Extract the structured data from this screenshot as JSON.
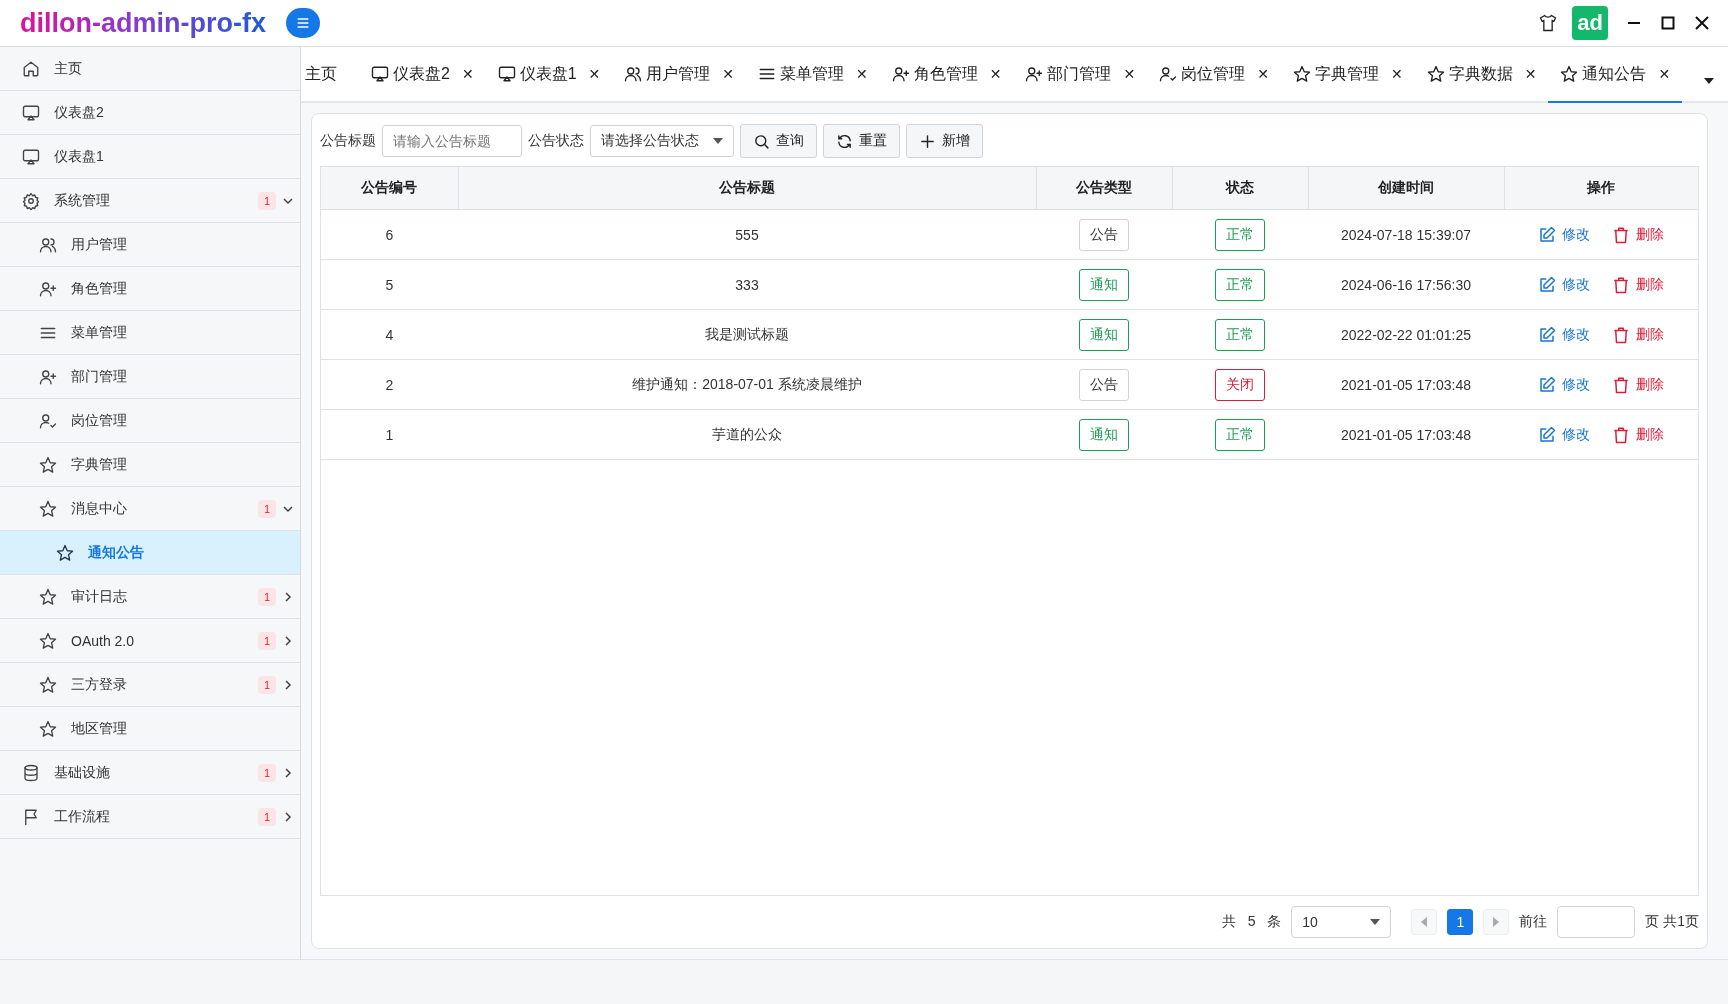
{
  "app_title": "dillon-admin-pro-fx",
  "avatar": "ad",
  "sidebar": [
    {
      "kind": "home",
      "label": "主页",
      "selected": false
    },
    {
      "kind": "monitor",
      "label": "仪表盘2",
      "selected": false
    },
    {
      "kind": "monitor",
      "label": "仪表盘1",
      "selected": false
    },
    {
      "kind": "gear",
      "label": "系统管理",
      "selected": false,
      "badge": "1",
      "expanded": true,
      "children": [
        {
          "kind": "users",
          "label": "用户管理",
          "selected": false
        },
        {
          "kind": "user-plus",
          "label": "角色管理",
          "selected": false
        },
        {
          "kind": "menu",
          "label": "菜单管理",
          "selected": false
        },
        {
          "kind": "user-plus",
          "label": "部门管理",
          "selected": false
        },
        {
          "kind": "user-check",
          "label": "岗位管理",
          "selected": false
        },
        {
          "kind": "star",
          "label": "字典管理",
          "selected": false
        },
        {
          "kind": "star",
          "label": "消息中心",
          "selected": false,
          "badge": "1",
          "expanded": true,
          "children": [
            {
              "kind": "star",
              "label": "通知公告",
              "selected": true
            }
          ]
        },
        {
          "kind": "star",
          "label": "审计日志",
          "selected": false,
          "badge": "1",
          "expanded": false
        },
        {
          "kind": "star",
          "label": "OAuth 2.0",
          "selected": false,
          "badge": "1",
          "expanded": false
        },
        {
          "kind": "star",
          "label": "三方登录",
          "selected": false,
          "badge": "1",
          "expanded": false
        },
        {
          "kind": "star",
          "label": "地区管理",
          "selected": false
        }
      ]
    },
    {
      "kind": "database",
      "label": "基础设施",
      "selected": false,
      "badge": "1",
      "expanded": false
    },
    {
      "kind": "flag",
      "label": "工作流程",
      "selected": false,
      "badge": "1",
      "expanded": false
    }
  ],
  "tabs": [
    {
      "kind": "text",
      "label": "主页",
      "selected": false,
      "closable": false
    },
    {
      "kind": "monitor",
      "label": "仪表盘2",
      "selected": false,
      "closable": true,
      "close": "✕"
    },
    {
      "kind": "monitor",
      "label": "仪表盘1",
      "selected": false,
      "closable": true,
      "close": "✕"
    },
    {
      "kind": "users",
      "label": "用户管理",
      "selected": false,
      "closable": true,
      "close": "✕"
    },
    {
      "kind": "menu",
      "label": "菜单管理",
      "selected": false,
      "closable": true,
      "close": "✕"
    },
    {
      "kind": "user-plus",
      "label": "角色管理",
      "selected": false,
      "closable": true,
      "close": "✕"
    },
    {
      "kind": "user-plus",
      "label": "部门管理",
      "selected": false,
      "closable": true,
      "close": "✕"
    },
    {
      "kind": "user-check",
      "label": "岗位管理",
      "selected": false,
      "closable": true,
      "close": "✕"
    },
    {
      "kind": "star",
      "label": "字典管理",
      "selected": false,
      "closable": true,
      "close": "✕"
    },
    {
      "kind": "star",
      "label": "字典数据",
      "selected": false,
      "closable": true,
      "close": "✕"
    },
    {
      "kind": "star",
      "label": "通知公告",
      "selected": true,
      "closable": true,
      "close": "✕"
    }
  ],
  "filters": {
    "title_label": "公告标题",
    "title_placeholder": "请输入公告标题",
    "status_label": "公告状态",
    "status_placeholder": "请选择公告状态",
    "buttons": [
      {
        "kind": "search",
        "label": "查询"
      },
      {
        "kind": "refresh",
        "label": "重置"
      },
      {
        "kind": "plus",
        "label": "新增"
      }
    ]
  },
  "table": {
    "columns": [
      "公告编号",
      "公告标题",
      "公告类型",
      "状态",
      "创建时间",
      "操作"
    ],
    "rows": [
      {
        "id": "6",
        "title": "555",
        "type": {
          "text": "公告",
          "kind": "plain"
        },
        "status": {
          "text": "正常",
          "kind": "ok"
        },
        "created": "2024-07-18 15:39:07",
        "edit": "修改",
        "delete": "删除"
      },
      {
        "id": "5",
        "title": "333",
        "type": {
          "text": "通知",
          "kind": "green"
        },
        "status": {
          "text": "正常",
          "kind": "ok"
        },
        "created": "2024-06-16 17:56:30",
        "edit": "修改",
        "delete": "删除"
      },
      {
        "id": "4",
        "title": "我是测试标题",
        "type": {
          "text": "通知",
          "kind": "green"
        },
        "status": {
          "text": "正常",
          "kind": "ok"
        },
        "created": "2022-02-22 01:01:25",
        "edit": "修改",
        "delete": "删除"
      },
      {
        "id": "2",
        "title": "维护通知：2018-07-01 系统凌晨维护",
        "type": {
          "text": "公告",
          "kind": "plain"
        },
        "status": {
          "text": "关闭",
          "kind": "closed"
        },
        "created": "2021-01-05 17:03:48",
        "edit": "修改",
        "delete": "删除"
      },
      {
        "id": "1",
        "title": "芋道的公众",
        "type": {
          "text": "通知",
          "kind": "green"
        },
        "status": {
          "text": "正常",
          "kind": "ok"
        },
        "created": "2021-01-05 17:03:48",
        "edit": "修改",
        "delete": "删除"
      }
    ]
  },
  "pagination": {
    "total_prefix": "共",
    "total": "5",
    "total_suffix": "条",
    "page_size": "10",
    "pages": [
      {
        "label": "1",
        "selected": true
      }
    ],
    "goto_label": "前往",
    "page_suffix": "页 共1页"
  }
}
